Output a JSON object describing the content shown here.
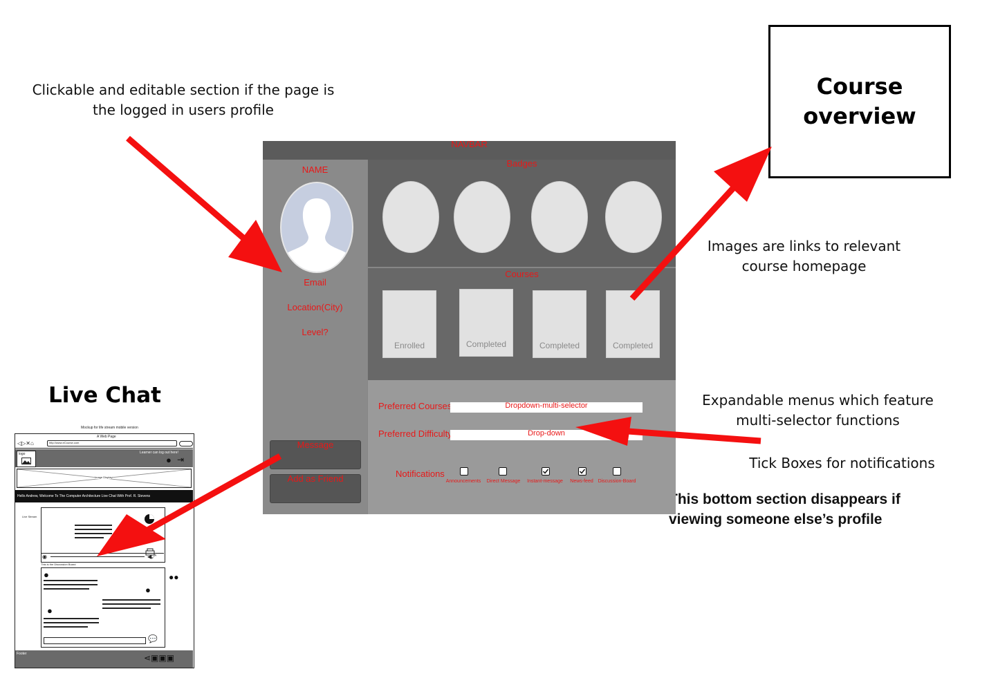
{
  "annotations": {
    "clickable_note": "Clickable and editable section if the page is the logged in users profile",
    "course_overview": "Course overview",
    "images_note": "Images are links to relevant course homepage",
    "expandable_note": "Expandable menus which feature multi-selector functions",
    "tick_note": "Tick Boxes for notifications",
    "bottom_note": "This bottom section disappears if viewing someone else’s profile",
    "live_chat_title": "Live Chat"
  },
  "profile": {
    "nav_label": "NAVBAR",
    "name": "NAME",
    "email": "Email",
    "location": "Location(City)",
    "level": "Level?",
    "message_button": "Message",
    "add_friend_button": "Add as Friend",
    "badges_label": "Badges",
    "courses_label": "Courses",
    "courses": [
      {
        "status": "Enrolled"
      },
      {
        "status": "Completed"
      },
      {
        "status": "Completed"
      },
      {
        "status": "Completed"
      }
    ],
    "preferred_courses_label": "Preferred Courses",
    "preferred_courses_value": "Dropdown-multi-selector",
    "preferred_difficulty_label": "Preferred Difficulty",
    "preferred_difficulty_value": "Drop-down",
    "notifications_label": "Notifications",
    "notifications": [
      {
        "label": "Announcements",
        "checked": false
      },
      {
        "label": "Direct Message",
        "checked": false
      },
      {
        "label": "Instant-message",
        "checked": true
      },
      {
        "label": "News-feed",
        "checked": true
      },
      {
        "label": "Discussion-Board",
        "checked": false
      }
    ]
  },
  "live_chat_mockup": {
    "caption": "Mockup for life stream mobile version",
    "window_title": "A Web Page",
    "url": "http://www.eCourse.com",
    "logo": "logo",
    "logout_text": "Learner can log out here!",
    "image_display": "Image Display",
    "welcome": "Hello Andrew, Welcome To The Computer Architecture Live Chat With Prof. R. Stevens",
    "live_stream": "Live Stream",
    "discussion_board": "This is the Discussion Board",
    "footer": "Footer"
  },
  "colors": {
    "annotation_arrow": "#f41010",
    "wireframe_red_text": "#e81818"
  }
}
